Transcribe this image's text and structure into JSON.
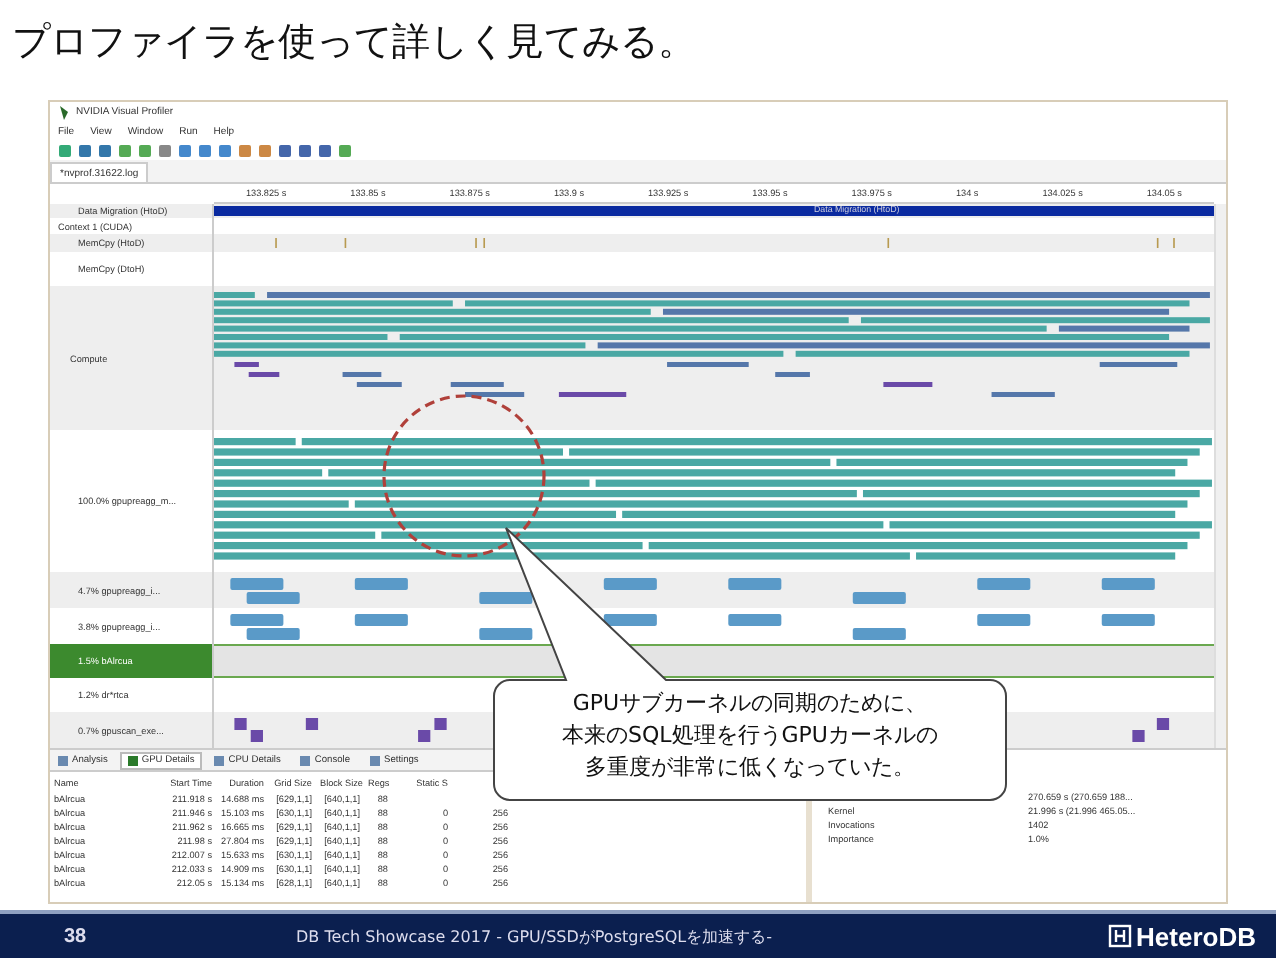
{
  "slide_title": "プロファイラを使って詳しく見てみる。",
  "window": {
    "title": "NVIDIA Visual Profiler",
    "menus": [
      "File",
      "View",
      "Window",
      "Run",
      "Help"
    ]
  },
  "editor_tab": {
    "label": "*nvprof.31622.log"
  },
  "timeline": {
    "ticks": [
      "133.825 s",
      "133.85 s",
      "133.875 s",
      "133.9 s",
      "133.925 s",
      "133.95 s",
      "133.975 s",
      "134 s",
      "134.025 s",
      "134.05 s"
    ],
    "migration_bar": "Data Migration (HtoD)",
    "rows": [
      {
        "label": "Data Migration (HtoD)",
        "kind": "migration",
        "selected": false
      },
      {
        "label": "Context 1 (CUDA)",
        "kind": "context",
        "selected": false
      },
      {
        "label": "MemCpy (HtoD)",
        "kind": "memcpy",
        "selected": false
      },
      {
        "label": "MemCpy (DtoH)",
        "kind": "empty",
        "selected": false
      },
      {
        "label": "Compute",
        "kind": "compute",
        "selected": false
      },
      {
        "label": "100.0% gpupreagg_m...",
        "kind": "main",
        "selected": false
      },
      {
        "label": "4.7% gpupreagg_i...",
        "kind": "blocks",
        "selected": false
      },
      {
        "label": "3.8% gpupreagg_i...",
        "kind": "blocks",
        "selected": false
      },
      {
        "label": "1.5% bAlrcua",
        "kind": "empty",
        "selected": true
      },
      {
        "label": "1.2% dr*rtca",
        "kind": "empty",
        "selected": false
      },
      {
        "label": "0.7% gpuscan_exe...",
        "kind": "small",
        "selected": false
      }
    ]
  },
  "callout": {
    "lines": [
      "GPUサブカーネルの同期のために、",
      "本来のSQL処理を行うGPUカーネルの",
      "多重度が非常に低くなっていた。"
    ]
  },
  "bottom_tabs": [
    {
      "label": "Analysis",
      "selected": false
    },
    {
      "label": "GPU Details",
      "selected": true
    },
    {
      "label": "CPU Details",
      "selected": false
    },
    {
      "label": "Console",
      "selected": false
    },
    {
      "label": "Settings",
      "selected": false
    }
  ],
  "details": {
    "columns": [
      "Name",
      "Start Time",
      "Duration",
      "Grid Size",
      "Block Size",
      "Regs",
      "Static S"
    ],
    "rows": [
      [
        "bAlrcua",
        "211.918 s",
        "14.688 ms",
        "[629,1,1]",
        "[640,1,1]",
        "88"
      ],
      [
        "bAlrcua",
        "211.946 s",
        "15.103 ms",
        "[630,1,1]",
        "[640,1,1]",
        "88",
        "0",
        "256"
      ],
      [
        "bAlrcua",
        "211.962 s",
        "16.665 ms",
        "[629,1,1]",
        "[640,1,1]",
        "88",
        "0",
        "256"
      ],
      [
        "bAlrcua",
        "211.98 s",
        "27.804 ms",
        "[629,1,1]",
        "[640,1,1]",
        "88",
        "0",
        "256"
      ],
      [
        "bAlrcua",
        "212.007 s",
        "15.633 ms",
        "[630,1,1]",
        "[640,1,1]",
        "88",
        "0",
        "256"
      ],
      [
        "bAlrcua",
        "212.033 s",
        "14.909 ms",
        "[630,1,1]",
        "[640,1,1]",
        "88",
        "0",
        "256"
      ],
      [
        "bAlrcua",
        "212.05 s",
        "15.134 ms",
        "[628,1,1]",
        "[640,1,1]",
        "88",
        "0",
        "256"
      ]
    ]
  },
  "properties": [
    {
      "value": "270.659 s (270.659 188..."
    },
    {
      "label": "Kernel",
      "value": "21.996 s (21.996 465.05..."
    },
    {
      "label": "Invocations",
      "value": "1402"
    },
    {
      "label": "Importance",
      "value": "1.0%"
    }
  ],
  "footer": {
    "page": "38",
    "text": "DB Tech Showcase 2017 - GPU/SSDがPostgreSQLを加速する-",
    "logo": "HeteroDB"
  }
}
